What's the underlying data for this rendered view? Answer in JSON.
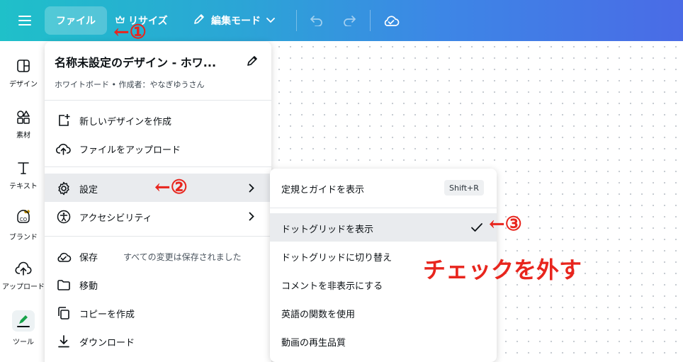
{
  "topbar": {
    "file_label": "ファイル",
    "resize_label": "リサイズ",
    "edit_mode_label": "編集モード",
    "icons": [
      "hamburger-menu-icon",
      "crown-icon",
      "pencil-icon",
      "chevron-down-icon",
      "undo-icon",
      "redo-icon",
      "cloud-check-icon"
    ]
  },
  "sidebar": {
    "items": [
      {
        "label": "デザイン",
        "icon": "design-icon"
      },
      {
        "label": "素材",
        "icon": "elements-icon"
      },
      {
        "label": "テキスト",
        "icon": "text-icon"
      },
      {
        "label": "ブランド",
        "icon": "brand-icon"
      },
      {
        "label": "アップロード",
        "icon": "upload-icon"
      },
      {
        "label": "ツール",
        "icon": "tools-icon"
      }
    ]
  },
  "file_menu": {
    "title": "名称未設定のデザイン - ホワ...",
    "subtitle": "ホワイトボード • 作成者：やなぎゆうさん",
    "items": [
      {
        "label": "新しいデザインを作成",
        "icon": "add-page-icon"
      },
      {
        "label": "ファイルをアップロード",
        "icon": "cloud-upload-icon"
      },
      {
        "label": "設定",
        "icon": "gear-icon"
      },
      {
        "label": "アクセシビリティ",
        "icon": "accessibility-icon"
      },
      {
        "label": "保存",
        "icon": "cloud-check-icon",
        "meta": "すべての変更は保存されました"
      },
      {
        "label": "移動",
        "icon": "folder-icon"
      },
      {
        "label": "コピーを作成",
        "icon": "copy-icon"
      },
      {
        "label": "ダウンロード",
        "icon": "download-icon"
      }
    ]
  },
  "settings_submenu": {
    "items": [
      {
        "label": "定規とガイドを表示",
        "shortcut": "Shift+R"
      },
      {
        "label": "ドットグリッドを表示",
        "checked": true
      },
      {
        "label": "ドットグリッドに切り替え"
      },
      {
        "label": "コメントを非表示にする"
      },
      {
        "label": "英語の関数を使用"
      },
      {
        "label": "動画の再生品質"
      }
    ]
  },
  "annotations": {
    "step1": "←①",
    "step2": "←②",
    "step3": "←③",
    "instruction": "チェックを外す"
  },
  "colors": {
    "annotation": "#e8251d",
    "topbar_start": "#1fc0c9",
    "topbar_end": "#4a6be6",
    "hover_bg": "#e9ebee"
  }
}
